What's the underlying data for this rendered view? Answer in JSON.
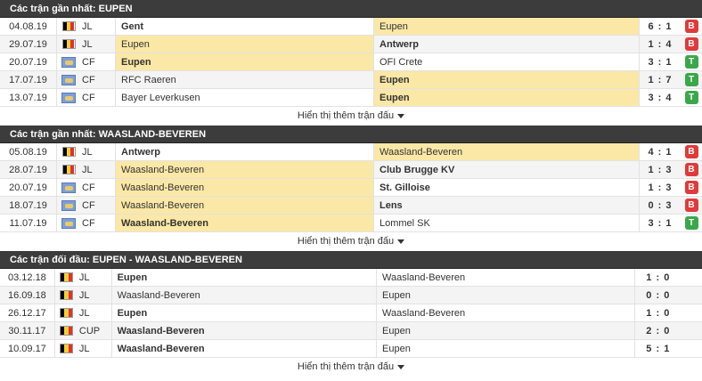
{
  "sections": [
    {
      "title": "Các trận gần nhất: EUPEN",
      "more_label": "Hiển thị thêm trận đấu",
      "rows": [
        {
          "date": "04.08.19",
          "flag": "BE",
          "comp": "JL",
          "home": "Gent",
          "home_bold": true,
          "home_hl": false,
          "away": "Eupen",
          "away_bold": false,
          "away_hl": true,
          "score": "6 : 1",
          "result": "B"
        },
        {
          "date": "29.07.19",
          "flag": "BE",
          "comp": "JL",
          "home": "Eupen",
          "home_bold": false,
          "home_hl": true,
          "away": "Antwerp",
          "away_bold": true,
          "away_hl": false,
          "score": "1 : 4",
          "result": "B"
        },
        {
          "date": "20.07.19",
          "flag": "CF",
          "comp": "CF",
          "home": "Eupen",
          "home_bold": true,
          "home_hl": true,
          "away": "OFI Crete",
          "away_bold": false,
          "away_hl": false,
          "score": "3 : 1",
          "result": "T"
        },
        {
          "date": "17.07.19",
          "flag": "CF",
          "comp": "CF",
          "home": "RFC Raeren",
          "home_bold": false,
          "home_hl": false,
          "away": "Eupen",
          "away_bold": true,
          "away_hl": true,
          "score": "1 : 7",
          "result": "T"
        },
        {
          "date": "13.07.19",
          "flag": "CF",
          "comp": "CF",
          "home": "Bayer Leverkusen",
          "home_bold": false,
          "home_hl": false,
          "away": "Eupen",
          "away_bold": true,
          "away_hl": true,
          "score": "3 : 4",
          "result": "T"
        }
      ]
    },
    {
      "title": "Các trận gần nhất: WAASLAND-BEVEREN",
      "more_label": "Hiển thị thêm trận đấu",
      "rows": [
        {
          "date": "05.08.19",
          "flag": "BE",
          "comp": "JL",
          "home": "Antwerp",
          "home_bold": true,
          "home_hl": false,
          "away": "Waasland-Beveren",
          "away_bold": false,
          "away_hl": true,
          "score": "4 : 1",
          "result": "B"
        },
        {
          "date": "28.07.19",
          "flag": "BE",
          "comp": "JL",
          "home": "Waasland-Beveren",
          "home_bold": false,
          "home_hl": true,
          "away": "Club Brugge KV",
          "away_bold": true,
          "away_hl": false,
          "score": "1 : 3",
          "result": "B"
        },
        {
          "date": "20.07.19",
          "flag": "CF",
          "comp": "CF",
          "home": "Waasland-Beveren",
          "home_bold": false,
          "home_hl": true,
          "away": "St. Gilloise",
          "away_bold": true,
          "away_hl": false,
          "score": "1 : 3",
          "result": "B"
        },
        {
          "date": "18.07.19",
          "flag": "CF",
          "comp": "CF",
          "home": "Waasland-Beveren",
          "home_bold": false,
          "home_hl": true,
          "away": "Lens",
          "away_bold": true,
          "away_hl": false,
          "score": "0 : 3",
          "result": "B"
        },
        {
          "date": "11.07.19",
          "flag": "CF",
          "comp": "CF",
          "home": "Waasland-Beveren",
          "home_bold": true,
          "home_hl": true,
          "away": "Lommel SK",
          "away_bold": false,
          "away_hl": false,
          "score": "3 : 1",
          "result": "T"
        }
      ]
    },
    {
      "title": "Các trận đối đầu: EUPEN - WAASLAND-BEVEREN",
      "more_label": "Hiển thị thêm trận đấu",
      "h2h": true,
      "rows": [
        {
          "date": "03.12.18",
          "flag": "BE",
          "comp": "JL",
          "home": "Eupen",
          "home_bold": true,
          "home_hl": false,
          "away": "Waasland-Beveren",
          "away_bold": false,
          "away_hl": false,
          "score": "1 : 0",
          "result": ""
        },
        {
          "date": "16.09.18",
          "flag": "BE",
          "comp": "JL",
          "home": "Waasland-Beveren",
          "home_bold": false,
          "home_hl": false,
          "away": "Eupen",
          "away_bold": false,
          "away_hl": false,
          "score": "0 : 0",
          "result": ""
        },
        {
          "date": "26.12.17",
          "flag": "BE",
          "comp": "JL",
          "home": "Eupen",
          "home_bold": true,
          "home_hl": false,
          "away": "Waasland-Beveren",
          "away_bold": false,
          "away_hl": false,
          "score": "1 : 0",
          "result": ""
        },
        {
          "date": "30.11.17",
          "flag": "BE",
          "comp": "CUP",
          "home": "Waasland-Beveren",
          "home_bold": true,
          "home_hl": false,
          "away": "Eupen",
          "away_bold": false,
          "away_hl": false,
          "score": "2 : 0",
          "result": ""
        },
        {
          "date": "10.09.17",
          "flag": "BE",
          "comp": "JL",
          "home": "Waasland-Beveren",
          "home_bold": true,
          "home_hl": false,
          "away": "Eupen",
          "away_bold": false,
          "away_hl": false,
          "score": "5 : 1",
          "result": ""
        }
      ]
    }
  ],
  "colors": {
    "header_bg": "#3c3c3c",
    "highlight": "#fbe8a6",
    "loss": "#e03a3a",
    "win": "#3aa84a",
    "alt_row": "#f4f4f4"
  }
}
